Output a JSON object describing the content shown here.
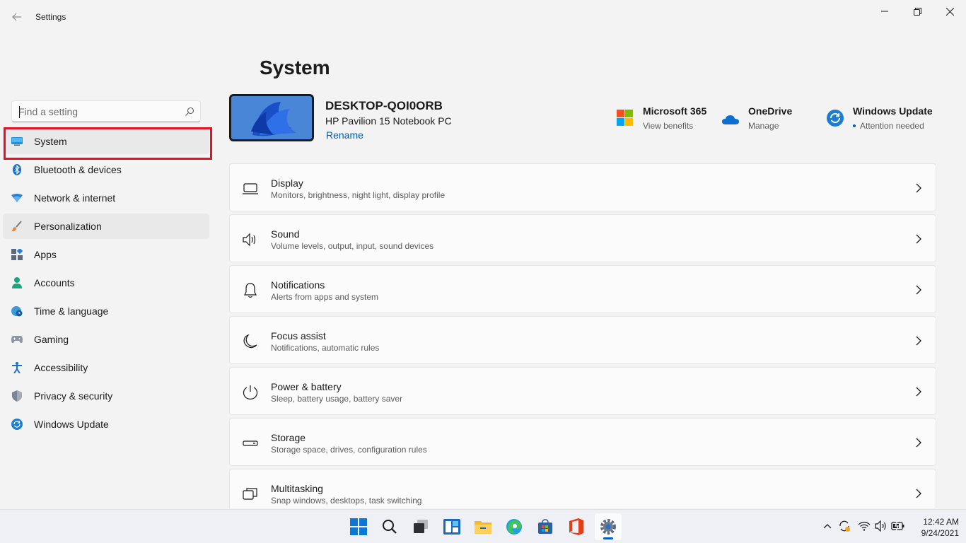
{
  "window": {
    "title": "Settings"
  },
  "search": {
    "placeholder": "Find a setting"
  },
  "sidebar": {
    "items": [
      {
        "label": "System",
        "icon": "monitor-icon"
      },
      {
        "label": "Bluetooth & devices",
        "icon": "bluetooth-icon"
      },
      {
        "label": "Network & internet",
        "icon": "wifi-icon"
      },
      {
        "label": "Personalization",
        "icon": "brush-icon"
      },
      {
        "label": "Apps",
        "icon": "apps-icon"
      },
      {
        "label": "Accounts",
        "icon": "person-icon"
      },
      {
        "label": "Time & language",
        "icon": "globe-clock-icon"
      },
      {
        "label": "Gaming",
        "icon": "gamepad-icon"
      },
      {
        "label": "Accessibility",
        "icon": "accessibility-icon"
      },
      {
        "label": "Privacy & security",
        "icon": "shield-icon"
      },
      {
        "label": "Windows Update",
        "icon": "update-icon"
      }
    ]
  },
  "main": {
    "title": "System",
    "device": {
      "name": "DESKTOP-QOI0ORB",
      "model": "HP Pavilion 15 Notebook PC",
      "rename": "Rename"
    },
    "quick_links": [
      {
        "title": "Microsoft 365",
        "subtitle": "View benefits",
        "icon": "microsoft-logo-icon"
      },
      {
        "title": "OneDrive",
        "subtitle": "Manage",
        "icon": "onedrive-icon"
      },
      {
        "title": "Windows Update",
        "subtitle": "Attention needed",
        "icon": "update-icon"
      }
    ],
    "cards": [
      {
        "title": "Display",
        "subtitle": "Monitors, brightness, night light, display profile",
        "icon": "display-icon"
      },
      {
        "title": "Sound",
        "subtitle": "Volume levels, output, input, sound devices",
        "icon": "speaker-icon"
      },
      {
        "title": "Notifications",
        "subtitle": "Alerts from apps and system",
        "icon": "bell-icon"
      },
      {
        "title": "Focus assist",
        "subtitle": "Notifications, automatic rules",
        "icon": "moon-icon"
      },
      {
        "title": "Power & battery",
        "subtitle": "Sleep, battery usage, battery saver",
        "icon": "power-icon"
      },
      {
        "title": "Storage",
        "subtitle": "Storage space, drives, configuration rules",
        "icon": "storage-icon"
      },
      {
        "title": "Multitasking",
        "subtitle": "Snap windows, desktops, task switching",
        "icon": "multitasking-icon"
      }
    ]
  },
  "taskbar": {
    "time": "12:42 AM",
    "date": "9/24/2021"
  },
  "colors": {
    "accent": "#005fb8",
    "highlight": "#e81123"
  }
}
